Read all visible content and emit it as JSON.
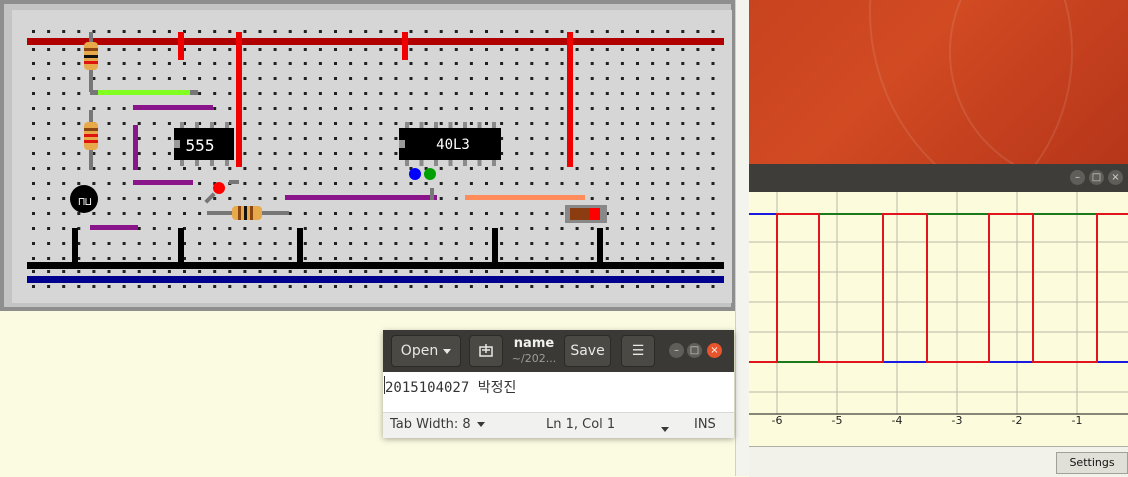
{
  "breadboard": {
    "chips": [
      {
        "label": "555"
      },
      {
        "label": "40L3"
      }
    ]
  },
  "scope": {
    "x_ticks": [
      "-6",
      "-5",
      "-4",
      "-3",
      "-2",
      "-1"
    ],
    "settings_label": "Settings",
    "colors": {
      "red": "#e0141e",
      "green": "#1c7a1c",
      "blue": "#1a1ae0"
    }
  },
  "editor": {
    "open_label": "Open",
    "title": "name",
    "subtitle": "~/202...",
    "save_label": "Save",
    "content": "2015104027 박정진",
    "tab_width": "Tab Width: 8",
    "position": "Ln 1, Col 1",
    "mode": "INS"
  }
}
